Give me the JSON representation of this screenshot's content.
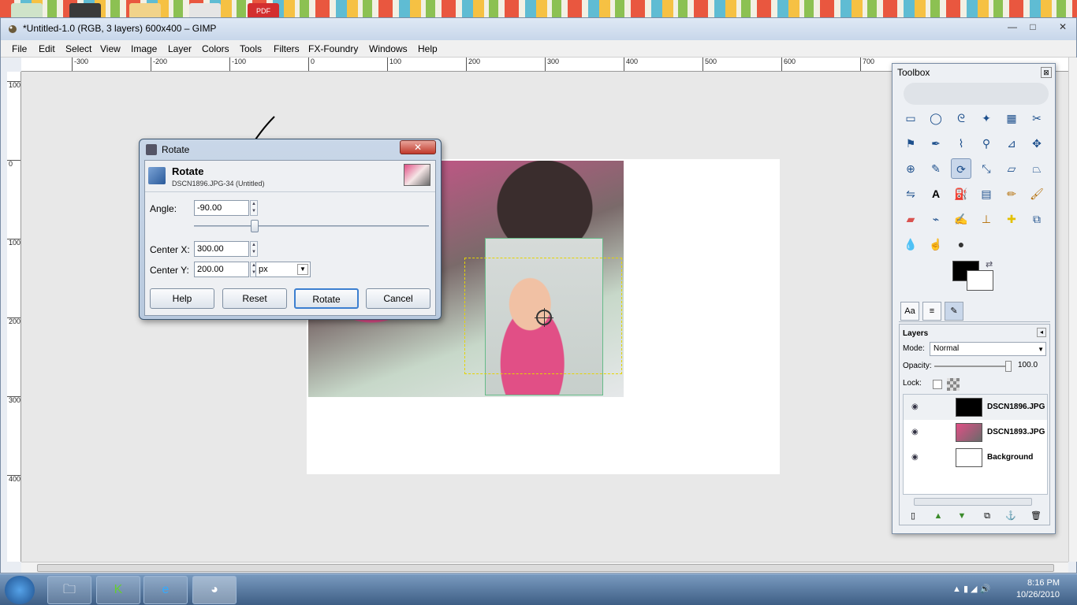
{
  "window": {
    "title": "*Untitled-1.0 (RGB, 3 layers) 600x400 – GIMP",
    "minimize": "—",
    "maximize": "□",
    "close": "✕"
  },
  "menubar": {
    "items": [
      "File",
      "Edit",
      "Select",
      "View",
      "Image",
      "Layer",
      "Colors",
      "Tools",
      "Filters",
      "FX-Foundry",
      "Windows",
      "Help"
    ]
  },
  "ruler": {
    "h_ticks": [
      "-300",
      "-200",
      "-100",
      "0",
      "100",
      "200",
      "300",
      "400",
      "500",
      "600",
      "700"
    ],
    "v_ticks": [
      "100",
      "0",
      "100",
      "200",
      "300",
      "400"
    ]
  },
  "rotate_dialog": {
    "title": "Rotate",
    "close": "✕",
    "heading": "Rotate",
    "subheading": "DSCN1896.JPG-34 (Untitled)",
    "angle_label": "Angle:",
    "angle_value": "-90.00",
    "centerx_label": "Center X:",
    "centerx_value": "300.00",
    "centery_label": "Center Y:",
    "centery_value": "200.00",
    "unit": "px",
    "buttons": {
      "help": "Help",
      "reset": "Reset",
      "rotate": "Rotate",
      "cancel": "Cancel"
    }
  },
  "toolbox": {
    "title": "Toolbox",
    "close": "⊠",
    "tabs": [
      "Aa",
      "≡",
      "✎"
    ]
  },
  "layers": {
    "title": "Layers",
    "mode_label": "Mode:",
    "mode_value": "Normal",
    "opacity_label": "Opacity:",
    "opacity_value": "100.0",
    "lock_label": "Lock:",
    "items": [
      {
        "name": "DSCN1896.JPG"
      },
      {
        "name": "DSCN1893.JPG"
      },
      {
        "name": "Background"
      }
    ]
  },
  "taskbar": {
    "time": "8:16 PM",
    "date": "10/26/2010"
  }
}
